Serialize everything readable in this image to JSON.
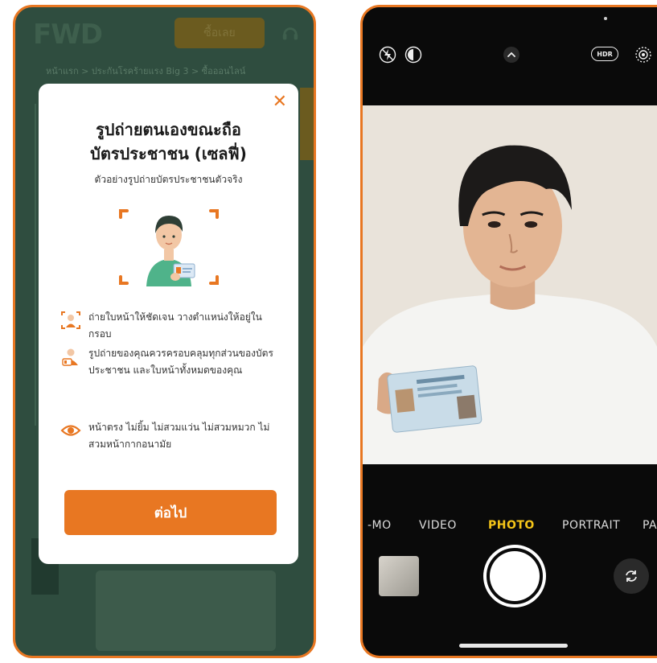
{
  "left_phone": {
    "header": {
      "logo": "FWD",
      "buy_button": "ซื้อเลย",
      "support_icon": "support-icon"
    },
    "breadcrumb": "หน้าแรก > ประกันโรคร้ายแรง Big 3 > ซื้อออนไลน์",
    "modal": {
      "close_icon": "close-icon",
      "title_line1": "รูปถ่ายตนเองขณะถือ",
      "title_line2": "บัตรประชาชน (เซลฟี่)",
      "subtitle": "ตัวอย่างรูปถ่ายบัตรประชาชนตัวจริง",
      "tips": [
        {
          "icon": "face-frame-icon",
          "text": "ถ่ายใบหน้าให้ชัดเจน วางตำแหน่งให้อยู่ในกรอบ"
        },
        {
          "icon": "person-id-card-icon",
          "text": "รูปถ่ายของคุณควรครอบคลุมทุกส่วนของบัตรประชาชน และใบหน้าทั้งหมดของคุณ"
        },
        {
          "icon": "eye-icon",
          "text": "หน้าตรง ไม่ยิ้ม ไม่สวมแว่น ไม่สวมหมวก ไม่สวมหน้ากากอนามัย"
        }
      ],
      "next_button": "ต่อไป"
    },
    "colors": {
      "accent": "#e87722",
      "overlay": "#2f4d3f"
    }
  },
  "right_phone": {
    "top_icons": [
      "flash-off-icon",
      "live-photo-icon",
      "chevron-up-icon",
      "hdr-badge",
      "live-icon"
    ],
    "hdr_label": "HDR",
    "modes": [
      {
        "label": "-MO",
        "active": false
      },
      {
        "label": "VIDEO",
        "active": false
      },
      {
        "label": "PHOTO",
        "active": true
      },
      {
        "label": "PORTRAIT",
        "active": false
      },
      {
        "label": "PA",
        "active": false
      }
    ],
    "colors": {
      "active_mode": "#f5c518"
    }
  }
}
